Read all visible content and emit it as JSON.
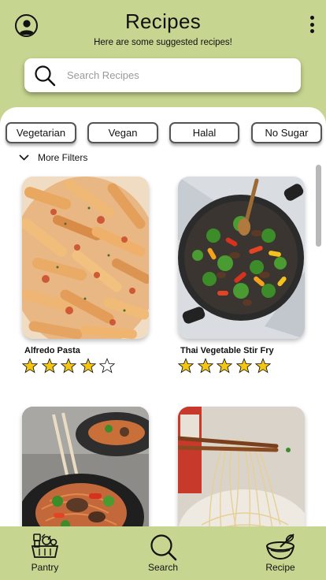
{
  "header": {
    "title": "Recipes",
    "subtitle": "Here are some suggested recipes!",
    "profile_icon": "user-circle-icon",
    "menu_icon": "kebab-menu-icon"
  },
  "search": {
    "placeholder": "Search Recipes",
    "value": "",
    "icon": "search-icon"
  },
  "filters": {
    "chips": [
      "Vegetarian",
      "Vegan",
      "Halal",
      "No Sugar"
    ],
    "more_label": "More Filters"
  },
  "recipes": [
    {
      "name": "Alfredo Pasta",
      "rating": 4,
      "max_rating": 5
    },
    {
      "name": "Thai Vegetable Stir Fry",
      "rating": 5,
      "max_rating": 5
    },
    {
      "name": "",
      "rating": null
    },
    {
      "name": "",
      "rating": null
    }
  ],
  "bottom_nav": {
    "items": [
      {
        "label": "Pantry",
        "icon": "grocery-basket-icon"
      },
      {
        "label": "Search",
        "icon": "search-icon"
      },
      {
        "label": "Recipe",
        "icon": "mixing-bowl-icon"
      }
    ]
  },
  "colors": {
    "background": "#c6d58f",
    "panel": "#ffffff",
    "star": "#f3c613"
  }
}
